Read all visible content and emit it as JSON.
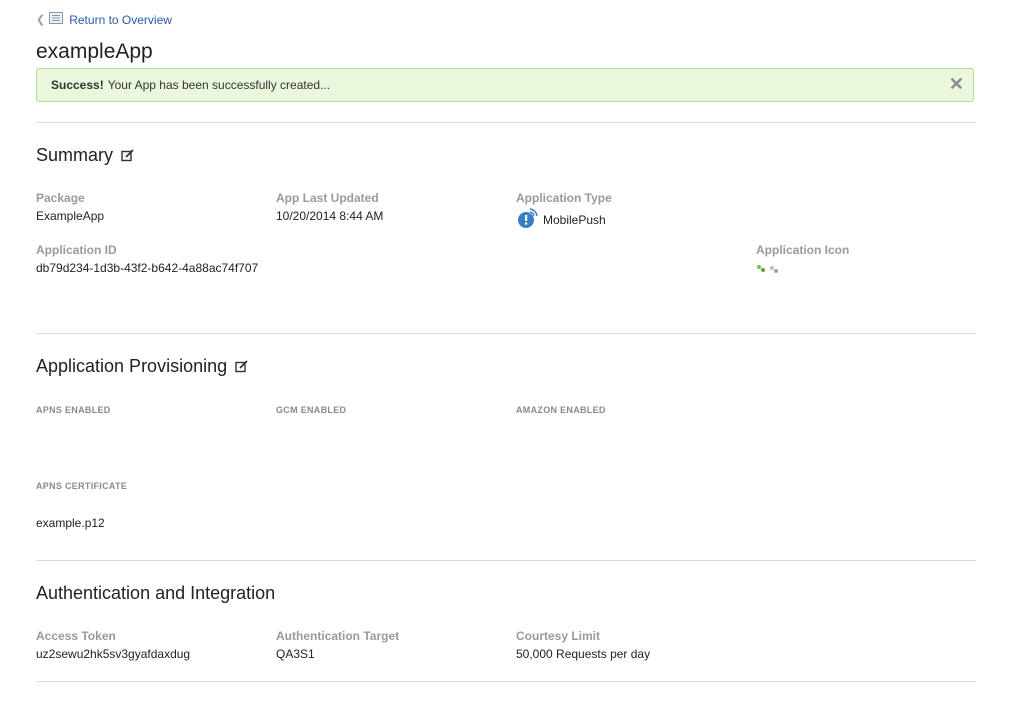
{
  "nav": {
    "back_label": "Return to Overview"
  },
  "app": {
    "name": "exampleApp"
  },
  "alert": {
    "strong": "Success!",
    "message": "Your App has been successfully created...",
    "close_glyph": "✕"
  },
  "summary": {
    "title": "Summary",
    "package_label": "Package",
    "package_value": "ExampleApp",
    "updated_label": "App Last Updated",
    "updated_value": "10/20/2014 8:44 AM",
    "type_label": "Application Type",
    "type_value": "MobilePush",
    "type_icon": "mobilepush-icon",
    "id_label": "Application ID",
    "id_value": "db79d234-1d3b-43f2-b642-4a88ac74f707",
    "icon_label": "Application Icon"
  },
  "provisioning": {
    "title": "Application Provisioning",
    "apns_enabled": "APNS ENABLED",
    "gcm_enabled": "GCM ENABLED",
    "amazon_enabled": "AMAZON ENABLED",
    "apns_cert_label": "APNS CERTIFICATE",
    "apns_cert_value": "example.p12"
  },
  "auth": {
    "title": "Authentication and Integration",
    "token_label": "Access Token",
    "token_value": "uz2sewu2hk5sv3gyafdaxdug",
    "target_label": "Authentication Target",
    "target_value": "QA3S1",
    "limit_label": "Courtesy Limit",
    "limit_value": "50,000 Requests per day"
  },
  "colors": {
    "link": "#2a5aa6",
    "success_bg": "#e9f7dd",
    "success_border": "#b7d99b",
    "label": "#9a9a9a",
    "icon_blue": "#3b7dc4"
  }
}
